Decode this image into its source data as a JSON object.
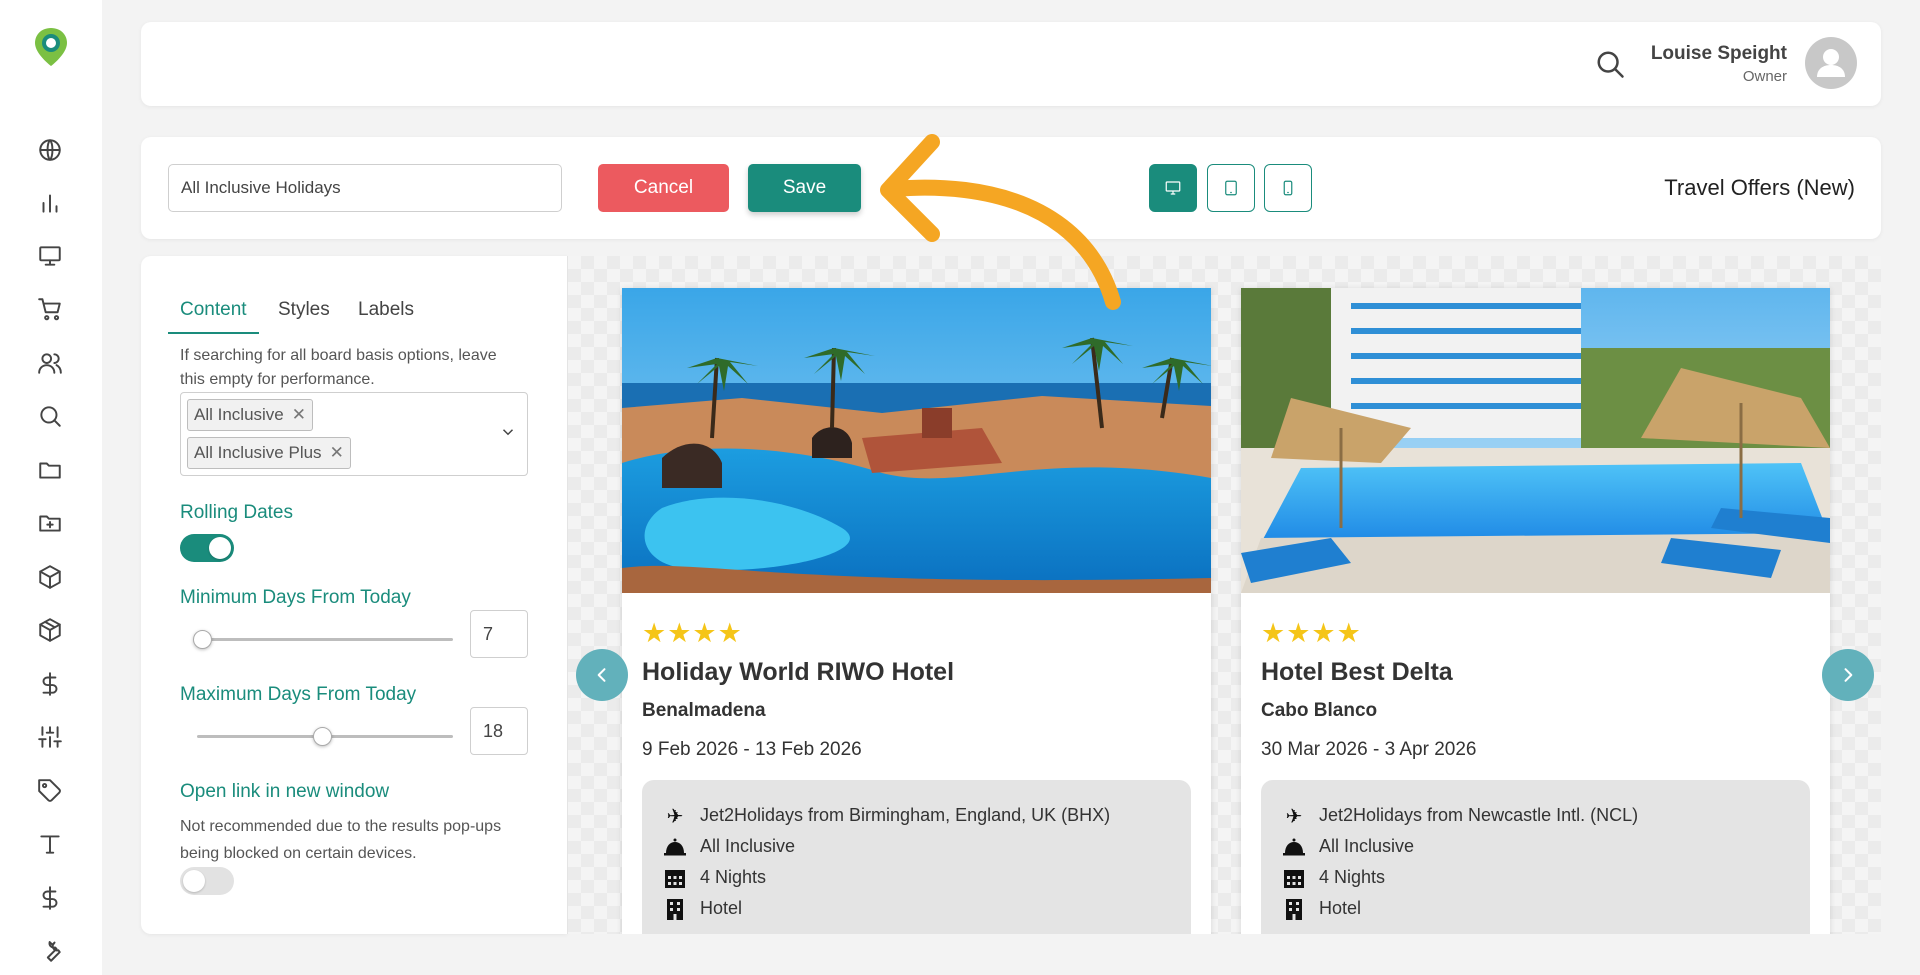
{
  "header": {
    "user_name": "Louise Speight",
    "user_role": "Owner"
  },
  "toolbar": {
    "name_value": "All Inclusive Holidays",
    "cancel_label": "Cancel",
    "save_label": "Save",
    "page_type": "Travel Offers (New)",
    "devices": [
      "desktop-icon",
      "tablet-icon",
      "mobile-icon"
    ]
  },
  "panel": {
    "tabs": [
      {
        "label": "Content",
        "active": true
      },
      {
        "label": "Styles",
        "active": false
      },
      {
        "label": "Labels",
        "active": false
      }
    ],
    "board_hint": "If searching for all board basis options, leave this empty for performance.",
    "board_tags": [
      "All Inclusive",
      "All Inclusive Plus"
    ],
    "rolling_dates_label": "Rolling Dates",
    "rolling_dates_on": true,
    "min_days_label": "Minimum Days From Today",
    "min_days_value": "7",
    "max_days_label": "Maximum Days From Today",
    "max_days_value": "18",
    "new_window_label": "Open link in new window",
    "new_window_hint": "Not recommended due to the results pop-ups being blocked on certain devices.",
    "new_window_on": false
  },
  "preview": {
    "cards": [
      {
        "stars": "★★★★",
        "hotel": "Holiday World RIWO Hotel",
        "location": "Benalmadena",
        "dates": "9 Feb 2026 - 13 Feb 2026",
        "details": [
          {
            "icon": "plane-icon",
            "text": "Jet2Holidays from Birmingham, England, UK (BHX)"
          },
          {
            "icon": "cloche-icon",
            "text": "All Inclusive"
          },
          {
            "icon": "calendar-icon",
            "text": "4 Nights"
          },
          {
            "icon": "building-icon",
            "text": "Hotel"
          }
        ]
      },
      {
        "stars": "★★★★",
        "hotel": "Hotel Best Delta",
        "location": "Cabo Blanco",
        "dates": "30 Mar 2026 - 3 Apr 2026",
        "details": [
          {
            "icon": "plane-icon",
            "text": "Jet2Holidays from Newcastle Intl. (NCL)"
          },
          {
            "icon": "cloche-icon",
            "text": "All Inclusive"
          },
          {
            "icon": "calendar-icon",
            "text": "4 Nights"
          },
          {
            "icon": "building-icon",
            "text": "Hotel"
          }
        ]
      }
    ]
  },
  "colors": {
    "brand": "#1a8c7c",
    "cancel": "#ec5a5f",
    "star": "#f5c518",
    "annotation": "#f5a623",
    "carousel_arrow": "#62b1bb"
  },
  "sidebar": {
    "icons": [
      "globe-icon",
      "bar-chart-icon",
      "monitor-icon",
      "cart-icon",
      "users-icon",
      "search-icon",
      "folder-icon",
      "folder-plus-icon",
      "box-icon",
      "package-icon",
      "dollar-icon",
      "sliders-icon",
      "tag-icon",
      "type-icon",
      "dollar-icon",
      "wrench-icon"
    ]
  }
}
